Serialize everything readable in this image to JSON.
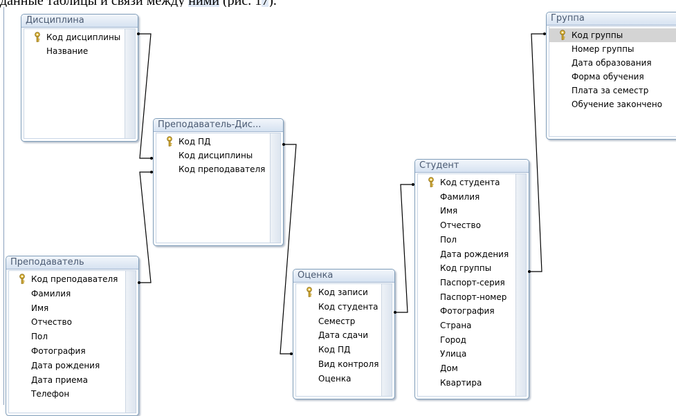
{
  "caption": {
    "before": "данные таблицы и связи между ",
    "highlight1": "ними",
    "middle": " (рис. 1",
    "highlight2": "7",
    "after": ")."
  },
  "tables": {
    "disciplina": {
      "title": "Дисциплина",
      "fields": [
        "Код дисциплины",
        "Название"
      ],
      "keys": [
        0
      ]
    },
    "prep_disc": {
      "title": "Преподаватель-Дис...",
      "fields": [
        "Код ПД",
        "Код дисциплины",
        "Код преподавателя"
      ],
      "keys": [
        0
      ]
    },
    "gruppa": {
      "title": "Группа",
      "fields": [
        "Код группы",
        "Номер группы",
        "Дата образования",
        "Форма обучения",
        "Плата за семестр",
        "Обучение закончено"
      ],
      "keys": [
        0
      ],
      "selected": 0
    },
    "student": {
      "title": "Студент",
      "fields": [
        "Код студента",
        "Фамилия",
        "Имя",
        "Отчество",
        "Пол",
        "Дата рождения",
        "Код группы",
        "Паспорт-серия",
        "Паспорт-номер",
        "Фотография",
        "Страна",
        "Город",
        "Улица",
        "Дом",
        "Квартира"
      ],
      "keys": [
        0
      ]
    },
    "ocenka": {
      "title": "Оценка",
      "fields": [
        "Код записи",
        "Код студента",
        "Семестр",
        "Дата сдачи",
        "Код ПД",
        "Вид контроля",
        "Оценка"
      ],
      "keys": [
        0
      ]
    },
    "prepodavatel": {
      "title": "Преподаватель",
      "fields": [
        "Код преподавателя",
        "Фамилия",
        "Имя",
        "Отчество",
        "Пол",
        "Фотография",
        "Дата рождения",
        "Дата приема",
        "Телефон"
      ],
      "keys": [
        0
      ]
    }
  },
  "colors": {
    "line": "#000000",
    "title_text": "#4a5a72",
    "border": "#7f9db9",
    "selected_row": "#d4d4d4"
  }
}
